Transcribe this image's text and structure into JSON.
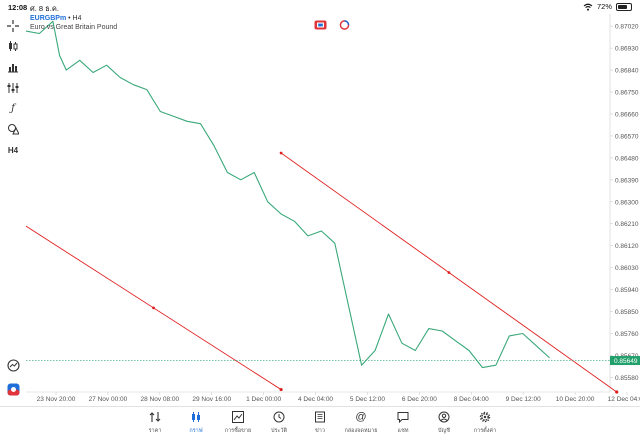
{
  "status_bar": {
    "time": "12:08",
    "date": "ศ. 8 ธ.ค.",
    "battery": "72%",
    "battery_level": 0.72
  },
  "chart_header": {
    "symbol": "EURGBPm",
    "timeframe": "• H4",
    "description": "Euro vs Great Britain Pound"
  },
  "left_toolbar": {
    "timeframe_label": "H4",
    "icons": [
      "crosshair-icon",
      "candlestick-icon",
      "bar-chart-icon",
      "indicators-icon",
      "function-icon",
      "shapes-icon",
      "timeframe-label",
      "trade-history-icon",
      "one-click-trade-icon"
    ]
  },
  "current_price": "0.85649",
  "colors": {
    "price_line": "#3aa87a",
    "trend_line": "#e02020",
    "current_price_tag": "#22a06b",
    "accent": "#1e6fd9",
    "axis_text": "#555555"
  },
  "chart_data": {
    "type": "line",
    "symbol": "EURGBPm",
    "timeframe": "H4",
    "y_ticks": [
      "0.87020",
      "0.86930",
      "0.86840",
      "0.86750",
      "0.86660",
      "0.86570",
      "0.86480",
      "0.86390",
      "0.86300",
      "0.86210",
      "0.86120",
      "0.86030",
      "0.85940",
      "0.85850",
      "0.85760",
      "0.85670",
      "0.85580"
    ],
    "x_ticks": [
      "23 Nov 20:00",
      "27 Nov 00:00",
      "28 Nov 08:00",
      "29 Nov 16:00",
      "1 Dec 00:00",
      "4 Dec 04:00",
      "5 Dec 12:00",
      "6 Dec 20:00",
      "8 Dec 04:00",
      "9 Dec 12:00",
      "10 Dec 20:00",
      "12 Dec 04:00"
    ],
    "ylim": [
      0.8552,
      0.8707
    ],
    "xlim": [
      0,
      43.5
    ],
    "series": [
      {
        "x": [
          0,
          1,
          2,
          2.5,
          3,
          4,
          5,
          6,
          7,
          8,
          9,
          10,
          11,
          12,
          13,
          14,
          15,
          16,
          17,
          18,
          19,
          20,
          21,
          22,
          23,
          24,
          25,
          26,
          27,
          28,
          29,
          30,
          31,
          32,
          33,
          34,
          35,
          36,
          37,
          38,
          39
        ],
        "y": [
          0.87,
          0.8699,
          0.8704,
          0.869,
          0.8684,
          0.8688,
          0.8683,
          0.8686,
          0.8681,
          0.8678,
          0.8676,
          0.8667,
          0.8665,
          0.8663,
          0.8662,
          0.8653,
          0.8642,
          0.8639,
          0.8642,
          0.863,
          0.8625,
          0.8622,
          0.8616,
          0.8618,
          0.8613,
          0.8588,
          0.8563,
          0.8569,
          0.8584,
          0.8572,
          0.8569,
          0.8578,
          0.8577,
          0.8573,
          0.8569,
          0.8562,
          0.8563,
          0.8575,
          0.8576,
          0.8571,
          0.8566
        ]
      }
    ],
    "trend_lines": [
      {
        "x": [
          0,
          19.0
        ],
        "y": [
          0.862,
          0.8553
        ]
      },
      {
        "x": [
          19.0,
          44.0
        ],
        "y": [
          0.865,
          0.8552
        ]
      }
    ],
    "current_price": 0.85649,
    "grid": false
  },
  "tab_bar": {
    "tabs": [
      {
        "label": "ราคา",
        "icon": "quotes-icon"
      },
      {
        "label": "กราฟ",
        "icon": "chart-icon"
      },
      {
        "label": "การซื้อขาย",
        "icon": "trade-icon"
      },
      {
        "label": "ประวัติ",
        "icon": "history-icon"
      },
      {
        "label": "ข่าว",
        "icon": "news-icon"
      },
      {
        "label": "กล่องจดหมาย",
        "icon": "mailbox-icon"
      },
      {
        "label": "แชท",
        "icon": "chat-icon"
      },
      {
        "label": "บัญชี",
        "icon": "account-icon"
      },
      {
        "label": "การตั้งค่า",
        "icon": "settings-icon"
      }
    ],
    "active": 1
  }
}
